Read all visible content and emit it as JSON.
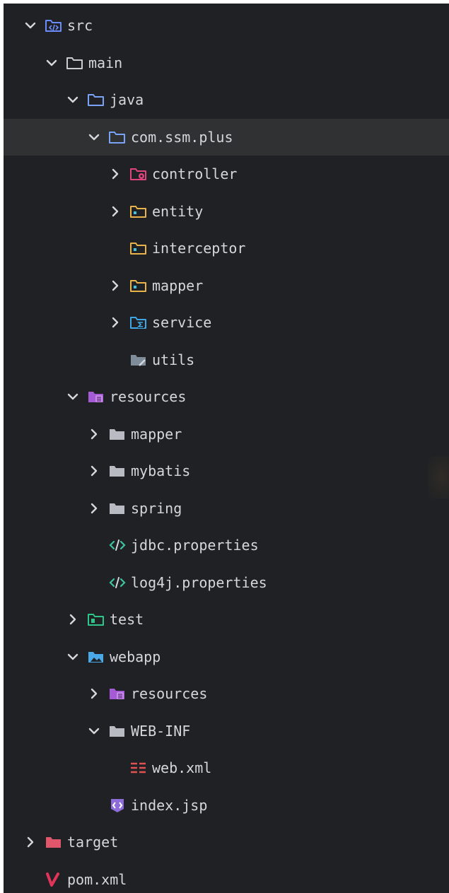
{
  "explorer": {
    "colors": {
      "background": "#1f2124",
      "selected_row": "#2f3133",
      "text": "#d4d7dc",
      "chevron": "#d4d7dc"
    },
    "items": [
      {
        "label": "src",
        "depth": 0,
        "expandable": true,
        "expanded": true,
        "icon": "src-folder-icon",
        "color": "#6b8cff",
        "selected": false
      },
      {
        "label": "main",
        "depth": 1,
        "expandable": true,
        "expanded": true,
        "icon": "folder-outline-icon",
        "color": "#c9ccd1",
        "selected": false
      },
      {
        "label": "java",
        "depth": 2,
        "expandable": true,
        "expanded": true,
        "icon": "folder-outline-icon",
        "color": "#7aa2f7",
        "selected": false
      },
      {
        "label": "com.ssm.plus",
        "depth": 3,
        "expandable": true,
        "expanded": true,
        "icon": "folder-outline-icon",
        "color": "#7aa2f7",
        "selected": true
      },
      {
        "label": "controller",
        "depth": 4,
        "expandable": true,
        "expanded": false,
        "icon": "controller-folder-icon",
        "color": "#e0457b",
        "selected": false
      },
      {
        "label": "entity",
        "depth": 4,
        "expandable": true,
        "expanded": false,
        "icon": "package-folder-icon",
        "color": "#e8b34b",
        "selected": false
      },
      {
        "label": "interceptor",
        "depth": 4,
        "expandable": false,
        "expanded": false,
        "icon": "package-folder-icon",
        "color": "#e8b34b",
        "selected": false
      },
      {
        "label": "mapper",
        "depth": 4,
        "expandable": true,
        "expanded": false,
        "icon": "package-folder-icon",
        "color": "#e8b34b",
        "selected": false
      },
      {
        "label": "service",
        "depth": 4,
        "expandable": true,
        "expanded": false,
        "icon": "service-folder-icon",
        "color": "#3fa7e8",
        "selected": false
      },
      {
        "label": "utils",
        "depth": 4,
        "expandable": false,
        "expanded": false,
        "icon": "utils-folder-icon",
        "color": "#7f8c99",
        "selected": false
      },
      {
        "label": "resources",
        "depth": 2,
        "expandable": true,
        "expanded": true,
        "icon": "resources-folder-icon",
        "color": "#a55ad6",
        "selected": false
      },
      {
        "label": "mapper",
        "depth": 3,
        "expandable": true,
        "expanded": false,
        "icon": "folder-solid-icon",
        "color": "#b8bcc2",
        "selected": false
      },
      {
        "label": "mybatis",
        "depth": 3,
        "expandable": true,
        "expanded": false,
        "icon": "folder-solid-icon",
        "color": "#b8bcc2",
        "selected": false
      },
      {
        "label": "spring",
        "depth": 3,
        "expandable": true,
        "expanded": false,
        "icon": "folder-solid-icon",
        "color": "#b8bcc2",
        "selected": false
      },
      {
        "label": "jdbc.properties",
        "depth": 3,
        "expandable": false,
        "expanded": false,
        "icon": "code-file-icon",
        "color": "#3fc2a0",
        "selected": false
      },
      {
        "label": "log4j.properties",
        "depth": 3,
        "expandable": false,
        "expanded": false,
        "icon": "code-file-icon",
        "color": "#3fc2a0",
        "selected": false
      },
      {
        "label": "test",
        "depth": 2,
        "expandable": true,
        "expanded": false,
        "icon": "test-folder-icon",
        "color": "#2fc48a",
        "selected": false
      },
      {
        "label": "webapp",
        "depth": 2,
        "expandable": true,
        "expanded": true,
        "icon": "webapp-folder-icon",
        "color": "#4aa8e8",
        "selected": false
      },
      {
        "label": "resources",
        "depth": 3,
        "expandable": true,
        "expanded": false,
        "icon": "resources-folder-icon",
        "color": "#a55ad6",
        "selected": false
      },
      {
        "label": "WEB-INF",
        "depth": 3,
        "expandable": true,
        "expanded": true,
        "icon": "folder-solid-icon",
        "color": "#b8bcc2",
        "selected": false
      },
      {
        "label": "web.xml",
        "depth": 4,
        "expandable": false,
        "expanded": false,
        "icon": "xml-file-icon",
        "color": "#e05252",
        "selected": false
      },
      {
        "label": "index.jsp",
        "depth": 3,
        "expandable": false,
        "expanded": false,
        "icon": "jsp-file-icon",
        "color": "#8d6bd8",
        "selected": false
      },
      {
        "label": "target",
        "depth": 0,
        "expandable": true,
        "expanded": false,
        "icon": "target-folder-icon",
        "color": "#e0566b",
        "selected": false
      },
      {
        "label": "pom.xml",
        "depth": 0,
        "expandable": false,
        "expanded": false,
        "icon": "maven-file-icon",
        "color": "#e0345a",
        "selected": false
      }
    ]
  }
}
